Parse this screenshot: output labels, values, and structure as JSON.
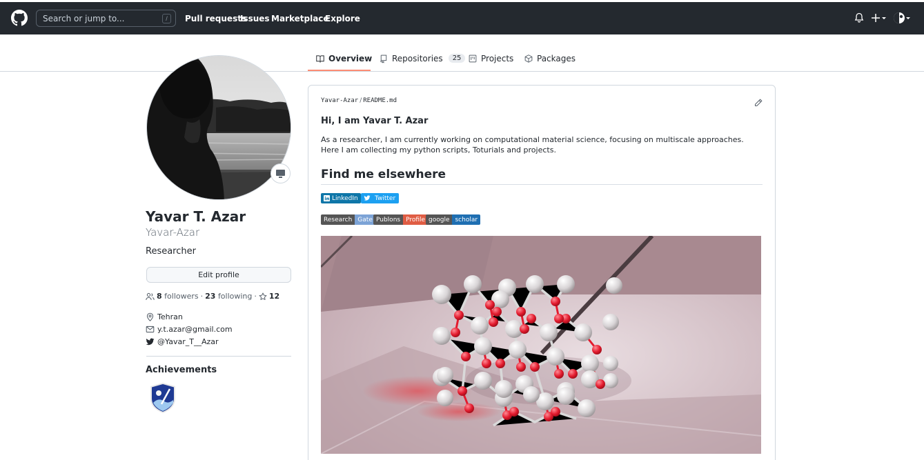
{
  "header": {
    "search_placeholder": "Search or jump to...",
    "search_shortcut": "/",
    "nav": [
      "Pull requests",
      "Issues",
      "Marketplace",
      "Explore"
    ]
  },
  "tabs": [
    {
      "label": "Overview",
      "icon": "book-icon"
    },
    {
      "label": "Repositories",
      "icon": "repo-icon",
      "count": "25"
    },
    {
      "label": "Projects",
      "icon": "project-icon"
    },
    {
      "label": "Packages",
      "icon": "package-icon"
    }
  ],
  "profile": {
    "name": "Yavar T. Azar",
    "login": "Yavar-Azar",
    "bio": "Researcher",
    "edit_label": "Edit profile",
    "followers": "8",
    "followers_label": "followers",
    "following": "23",
    "following_label": "following",
    "stars": "12",
    "location": "Tehran",
    "email": "y.t.azar@gmail.com",
    "twitter": "@Yavar_T__Azar",
    "achievements_title": "Achievements"
  },
  "readme": {
    "owner": "Yavar-Azar",
    "separator": "/",
    "file": "README.md",
    "heading": "Hi, I am Yavar T. Azar",
    "intro": "As a researcher, I am currently working on computational material science, focusing on multiscale approaches. Here I am collecting my python scripts, Toturials and projects.",
    "section_title": "Find me elsewhere",
    "social": [
      {
        "label": "LinkedIn",
        "color": "#0e76a8"
      },
      {
        "label": "Twitter",
        "color": "#1ca0f1"
      }
    ],
    "academic": [
      {
        "left": "Research",
        "right": "Gate",
        "right_color": "#7ca3d6"
      },
      {
        "left": "Publons",
        "right": "Profile",
        "right_color": "#e05d44"
      },
      {
        "left": "google",
        "right": "scholar",
        "right_color": "#1f6fb2"
      }
    ]
  },
  "colors": {
    "header_bg": "#24292f",
    "tab_accent": "#fd8c73",
    "shield_dark": "#555555"
  }
}
